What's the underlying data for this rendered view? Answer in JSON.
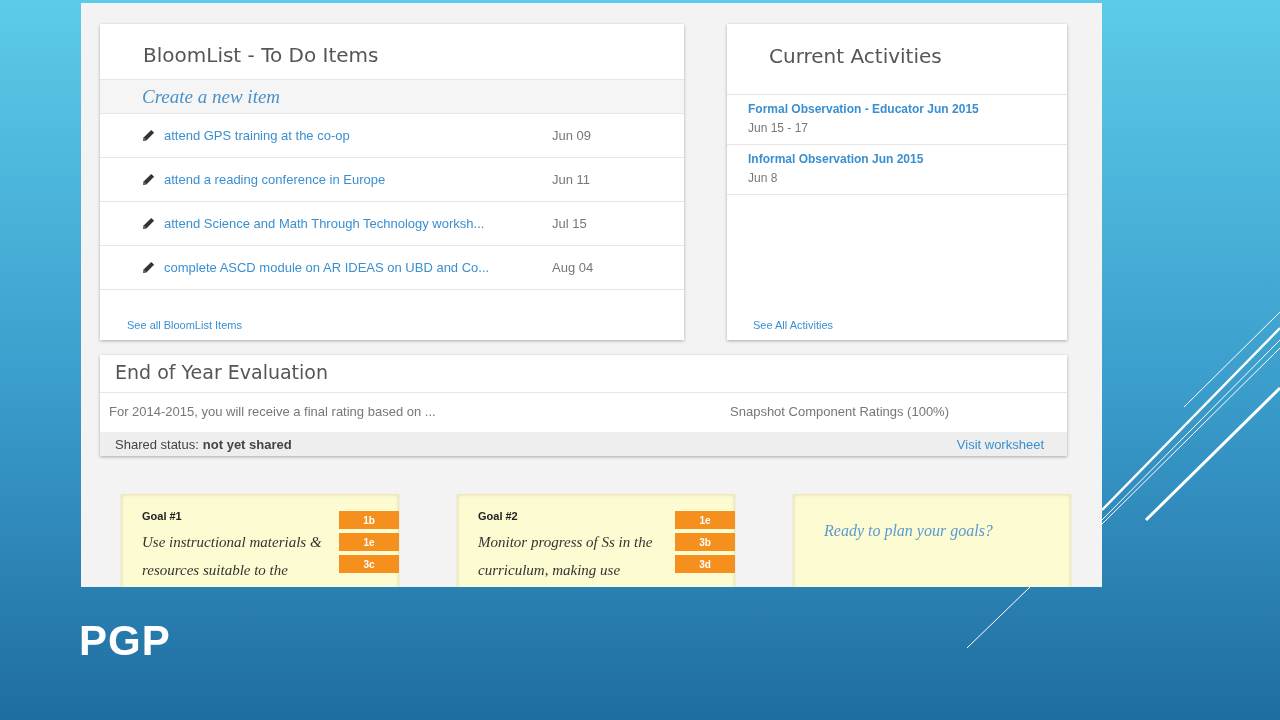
{
  "slide": {
    "title": "PGP"
  },
  "bloomlist": {
    "title": "BloomList - To Do Items",
    "create_link": "Create a new item",
    "items": [
      {
        "text": "attend GPS training at the co-op",
        "date": "Jun 09"
      },
      {
        "text": "attend a reading conference in Europe",
        "date": "Jun 11"
      },
      {
        "text": "attend Science and Math Through Technology worksh...",
        "date": "Jul 15"
      },
      {
        "text": "complete ASCD module on AR IDEAS on UBD and Co...",
        "date": "Aug 04"
      }
    ],
    "footer_link": "See all BloomList Items"
  },
  "activities": {
    "title": "Current Activities",
    "items": [
      {
        "title": "Formal Observation - Educator Jun 2015",
        "dates": "Jun 15 - 17"
      },
      {
        "title": "Informal Observation Jun 2015",
        "dates": "Jun 8"
      }
    ],
    "footer_link": "See All Activities"
  },
  "evaluation": {
    "title": "End of Year Evaluation",
    "description": "For 2014-2015, you will receive a final rating based on ...",
    "ratings": "Snapshot Component Ratings (100%)",
    "status_label": "Shared status:",
    "status_value": "not yet shared",
    "worksheet_link": "Visit worksheet"
  },
  "goals": [
    {
      "kind": "goal",
      "label": "Goal #1",
      "text": "Use instructional materials & resources suitable to the",
      "tags": [
        "1b",
        "1e",
        "3c"
      ]
    },
    {
      "kind": "goal",
      "label": "Goal #2",
      "text": "Monitor progress of Ss in the curriculum, making use",
      "tags": [
        "1e",
        "3b",
        "3d"
      ]
    },
    {
      "kind": "prompt",
      "text": "Ready to plan your goals?"
    }
  ]
}
